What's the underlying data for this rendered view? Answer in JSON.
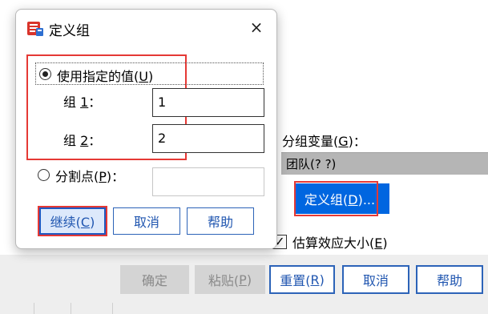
{
  "dialog": {
    "title": "定义组",
    "option_specified": {
      "text": "使用指定的值(",
      "mnemonic": "U",
      "suffix": ")"
    },
    "group1": {
      "prefix": "组 ",
      "mnemonic": "1",
      "suffix": "：",
      "value": "1"
    },
    "group2": {
      "prefix": "组 ",
      "mnemonic": "2",
      "suffix": "：",
      "value": "2"
    },
    "option_cutpoint": {
      "text": "分割点(",
      "mnemonic": "P",
      "suffix": ")："
    },
    "cutpoint_value": "",
    "buttons": {
      "continue": {
        "text": "继续(",
        "mnemonic": "C",
        "suffix": ")"
      },
      "cancel": "取消",
      "help": "帮助"
    }
  },
  "parent": {
    "grouping_variable": {
      "text": "分组变量(",
      "mnemonic": "G",
      "suffix": ")："
    },
    "grouping_value": "团队(? ?)",
    "define_groups_button": {
      "text": "定义组(",
      "mnemonic": "D",
      "suffix": ")..."
    },
    "estimate_effect": {
      "text": "估算效应大小(",
      "mnemonic": "E",
      "suffix": ")",
      "checked": true,
      "check_glyph": "✓"
    },
    "buttons": {
      "ok": "确定",
      "paste": {
        "text": "粘贴(",
        "mnemonic": "P",
        "suffix": ")"
      },
      "reset": {
        "text": "重置(",
        "mnemonic": "R",
        "suffix": ")"
      },
      "cancel": "取消",
      "help": "帮助"
    }
  },
  "icons": {
    "close": "×"
  },
  "colors": {
    "accent": "#0066e0",
    "highlight_red": "#e53935",
    "button_border": "#2c63b8"
  }
}
